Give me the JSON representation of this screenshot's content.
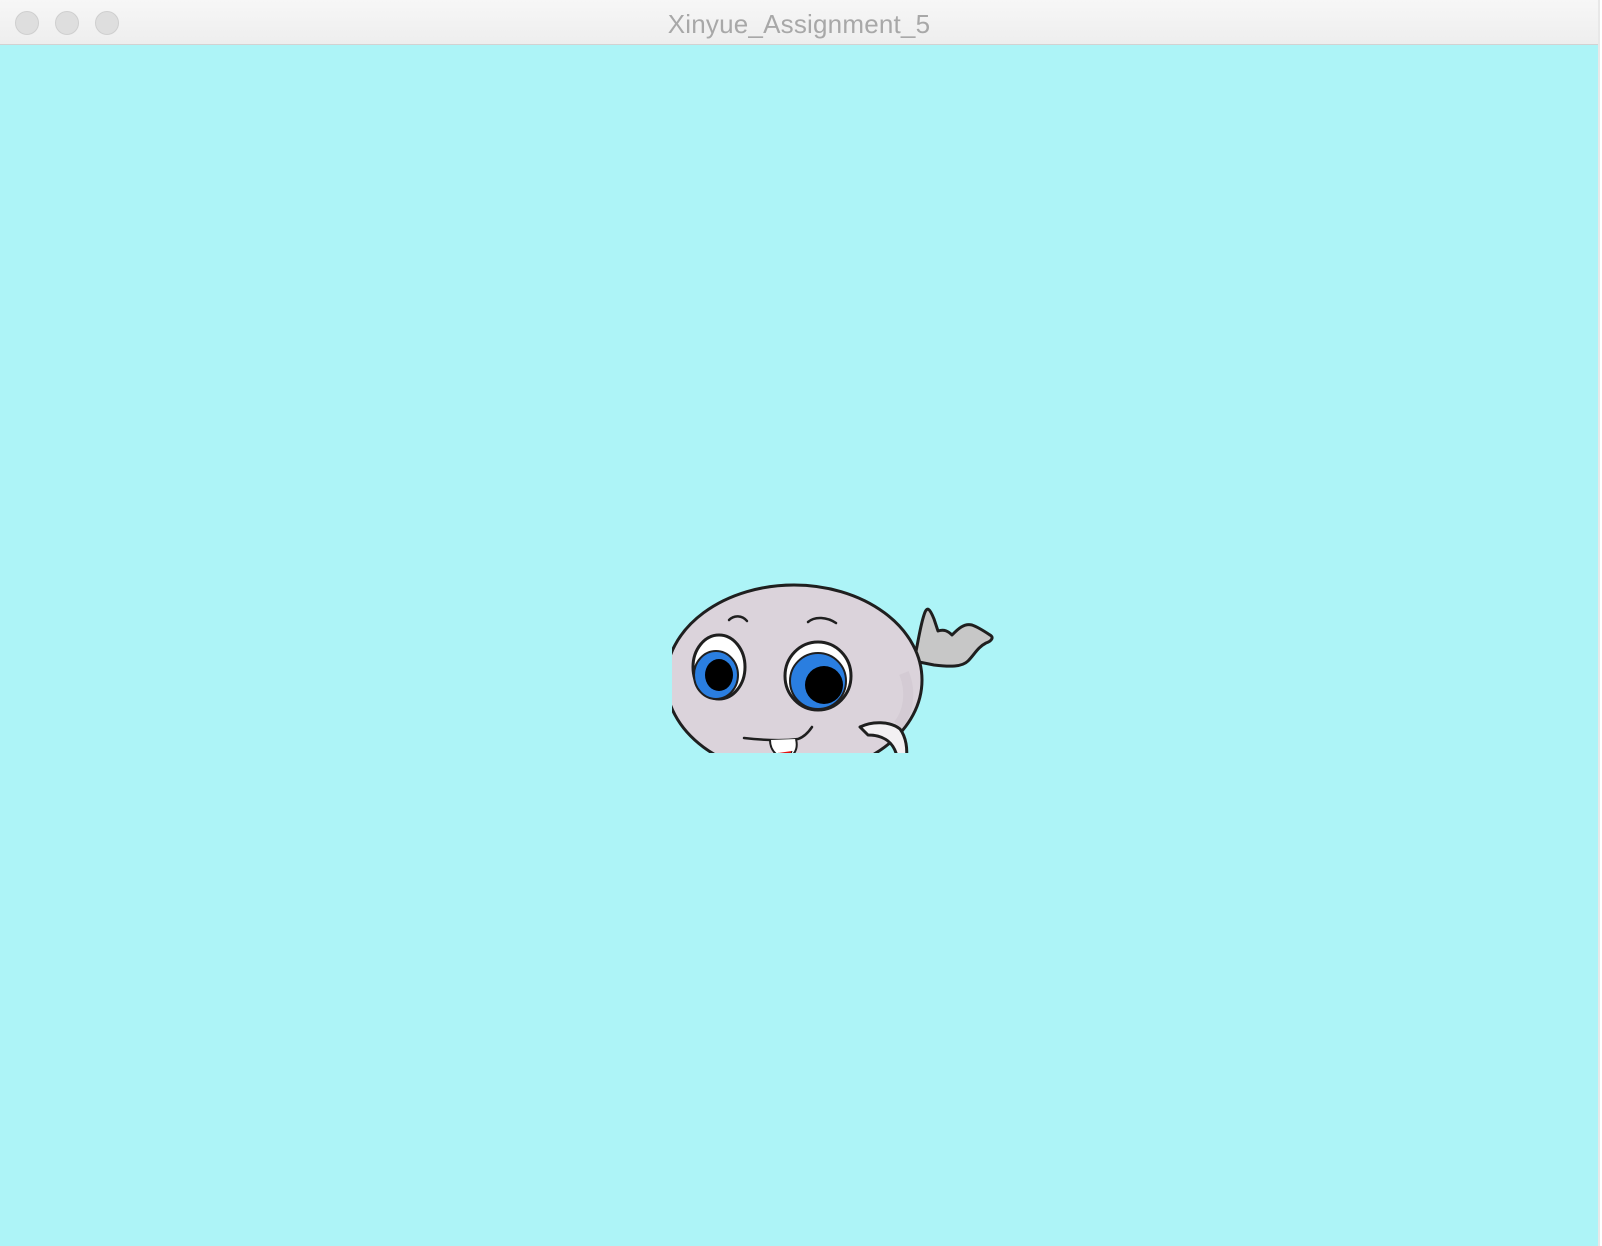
{
  "window": {
    "title": "Xinyue_Assignment_5",
    "buttons": {
      "close": "close",
      "minimize": "minimize",
      "zoom": "zoom"
    }
  },
  "canvas": {
    "background_color": "#adf4f7",
    "sprite": {
      "name": "cartoon whale",
      "body_color": "#dbd3db",
      "tail_color": "#c7c7c7",
      "eye_iris_color": "#2a7ee0",
      "outline_color": "#1f1f1f",
      "tongue_color": "#e01010"
    }
  }
}
